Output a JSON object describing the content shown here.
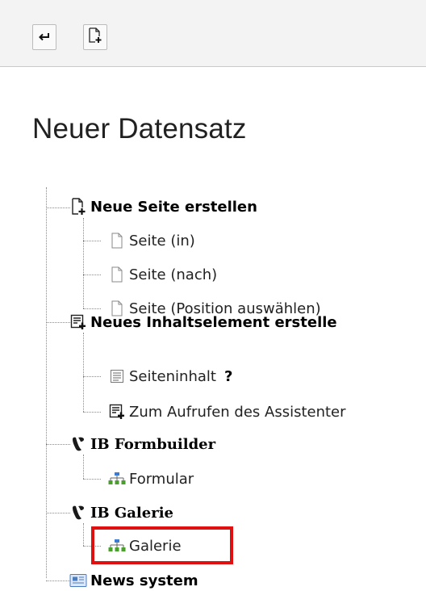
{
  "toolbar": {
    "back_icon": "return-arrow-icon",
    "new_icon": "new-document-plus-icon"
  },
  "page": {
    "title": "Neuer Datensatz"
  },
  "tree": {
    "new_page": {
      "label": "Neue Seite erstellen",
      "icon": "new-page-icon",
      "children": [
        {
          "label": "Seite (in)",
          "icon": "page-icon"
        },
        {
          "label": "Seite (nach)",
          "icon": "page-icon"
        },
        {
          "label": "Seite (Position auswählen)",
          "icon": "page-icon"
        }
      ]
    },
    "new_content": {
      "label": "Neues Inhaltselement erstelle",
      "icon": "content-element-icon",
      "children": [
        {
          "label": "Seiteninhalt",
          "icon": "text-lines-icon",
          "help": "?"
        },
        {
          "label": "Zum Aufrufen des Assistenter",
          "icon": "content-element-icon"
        }
      ]
    },
    "formbuilder": {
      "label": "IB Formbuilder",
      "icon": "typo3-extension-icon",
      "children": [
        {
          "label": "Formular",
          "icon": "sitemap-icon"
        }
      ]
    },
    "galerie": {
      "label": "IB Galerie",
      "icon": "typo3-extension-icon",
      "children": [
        {
          "label": "Galerie",
          "icon": "sitemap-icon"
        }
      ]
    },
    "news": {
      "label": "News system",
      "icon": "news-icon"
    }
  },
  "colors": {
    "highlight": "#e01010",
    "sitemap_green": "#4aa02c",
    "sitemap_blue": "#3b7bd1"
  }
}
